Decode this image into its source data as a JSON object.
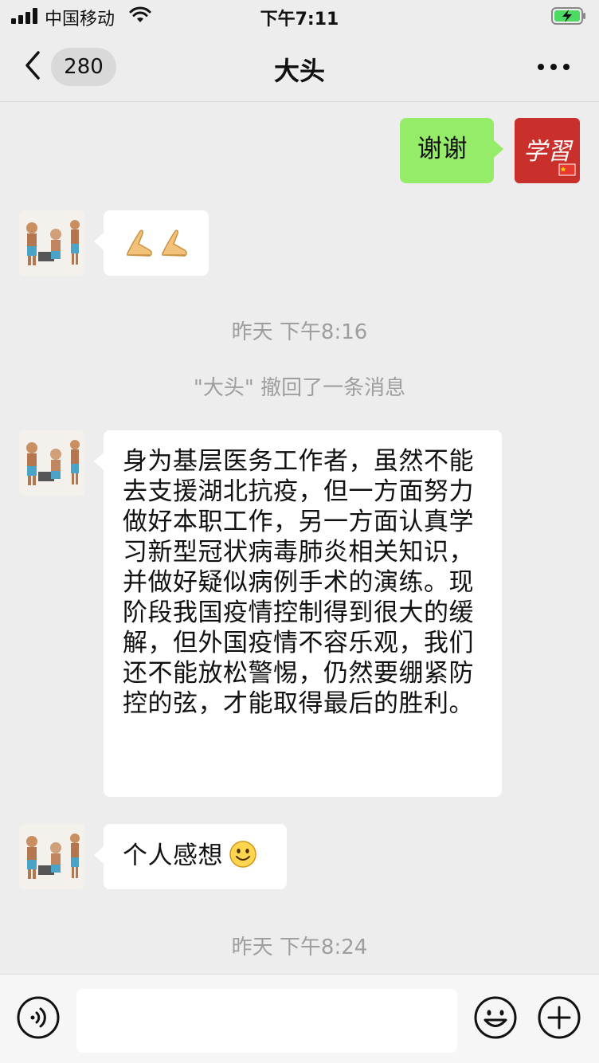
{
  "status_bar": {
    "carrier": "中国移动",
    "time": "下午7:11"
  },
  "nav": {
    "unread_count": "280",
    "title": "大头",
    "back_icon": "chevron-left-icon",
    "more_icon": "more-dots-icon"
  },
  "messages": {
    "thanks": "谢谢",
    "time_1": "昨天 下午8:16",
    "recall_notice": "\"大头\" 撤回了一条消息",
    "long_text": "身为基层医务工作者，虽然不能去支援湖北抗疫，但一方面努力做好本职工作，另一方面认真学习新型冠状病毒肺炎相关知识，并做好疑似病例手术的演练。现阶段我国疫情控制得到很大的缓解，但外国疫情不容乐观，我们还不能放松警惕，仍然要绷紧防控的弦，才能取得最后的胜利。",
    "feeling": "个人感想",
    "time_2": "昨天 下午8:24"
  },
  "self_avatar_text": "学習",
  "colors": {
    "background": "#ededed",
    "sent_bubble": "#95ec69",
    "received_bubble": "#ffffff",
    "timestamp": "#9e9e9e",
    "self_avatar": "#c9302c"
  }
}
